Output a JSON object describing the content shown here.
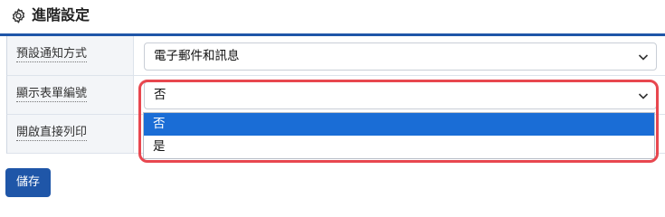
{
  "section": {
    "title": "進階設定",
    "icon": "gear-icon"
  },
  "rows": [
    {
      "label": "預設通知方式",
      "value": "電子郵件和訊息"
    },
    {
      "label": "顯示表單編號",
      "value": "否"
    },
    {
      "label": "開啟直接列印"
    }
  ],
  "dropdown": {
    "options": [
      "否",
      "是"
    ],
    "highlighted_index": 0
  },
  "actions": {
    "save_label": "儲存"
  },
  "colors": {
    "accent": "#1f56a8",
    "option_highlight": "#1a6dd6",
    "annotation_frame": "#e8474f"
  }
}
